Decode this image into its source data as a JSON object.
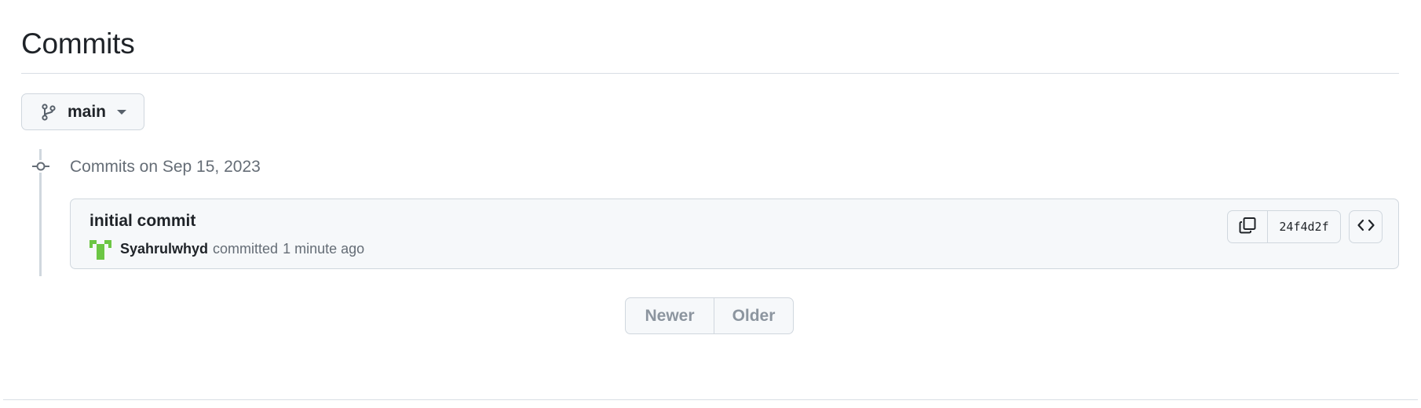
{
  "header": {
    "title": "Commits"
  },
  "branch_selector": {
    "branch": "main",
    "icon": "git-branch-icon"
  },
  "timeline": {
    "group_heading": "Commits on Sep 15, 2023"
  },
  "commits": [
    {
      "message": "initial commit",
      "author": "Syahrulwhyd",
      "action": "committed",
      "time": "1 minute ago",
      "sha": "24f4d2f",
      "icons": {
        "copy": "copy-icon",
        "browse": "code-icon",
        "avatar": "identicon-avatar"
      }
    }
  ],
  "pagination": {
    "newer": "Newer",
    "older": "Older"
  },
  "colors": {
    "text_primary": "#1f2328",
    "text_muted": "#656d76",
    "border": "#d0d7de",
    "surface": "#f6f8fa",
    "avatar_green": "#6cc644",
    "disabled_text": "#8c959f"
  }
}
